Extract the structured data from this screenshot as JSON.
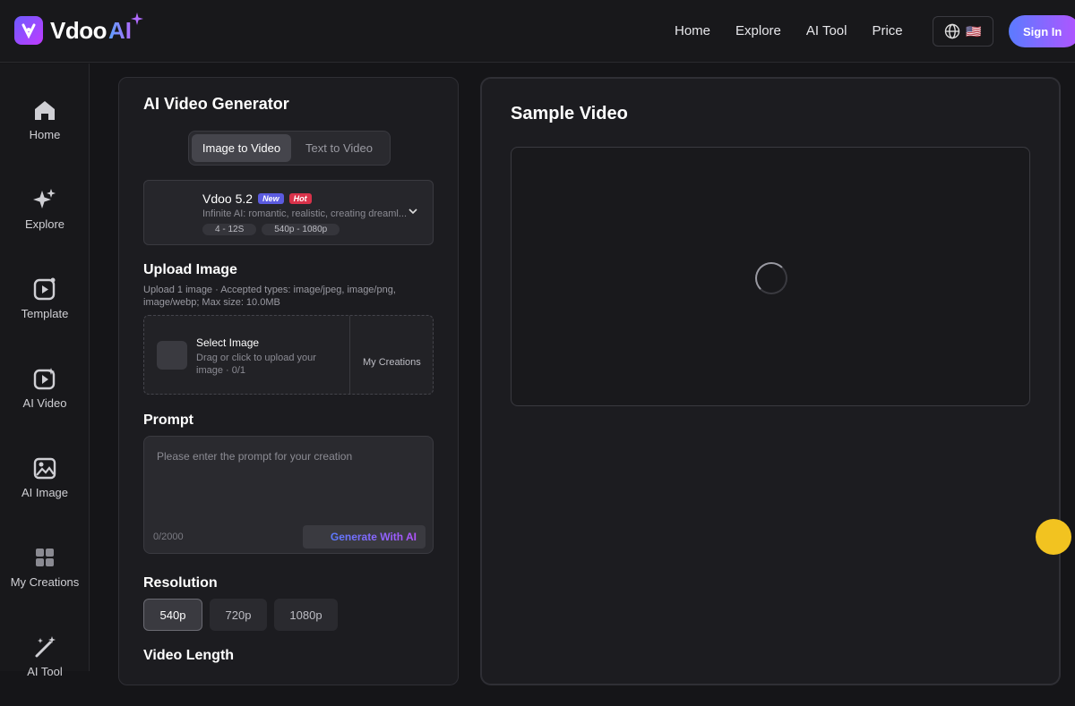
{
  "brand": {
    "name": "Vdoo",
    "ai": "AI"
  },
  "nav": {
    "items": [
      "Home",
      "Explore",
      "AI Tool",
      "Price"
    ]
  },
  "lang": {
    "flag": "🇺🇸"
  },
  "auth": {
    "signin": "Sign In"
  },
  "sidebar": {
    "items": [
      {
        "label": "Home",
        "icon": "home-icon"
      },
      {
        "label": "Explore",
        "icon": "sparkles-icon"
      },
      {
        "label": "Template",
        "icon": "template-icon"
      },
      {
        "label": "AI Video",
        "icon": "ai-video-icon"
      },
      {
        "label": "AI Image",
        "icon": "ai-image-icon"
      },
      {
        "label": "My Creations",
        "icon": "grid-icon"
      },
      {
        "label": "AI Tool",
        "icon": "magic-wand-icon"
      }
    ]
  },
  "generator": {
    "title": "AI Video Generator",
    "tabs": [
      "Image to Video",
      "Text to Video"
    ],
    "model": {
      "name": "Vdoo 5.2",
      "badge_new": "New",
      "badge_hot": "Hot",
      "description": "Infinite AI: romantic, realistic, creating dreaml...",
      "duration": "4 - 12S",
      "resolution_range": "540p - 1080p"
    },
    "upload": {
      "title": "Upload Image",
      "hint": "Upload 1 image · Accepted types: image/jpeg, image/png, image/webp; Max size: 10.0MB",
      "select_title": "Select Image",
      "select_sub": "Drag or click to upload your image · 0/1",
      "my_creations": "My Creations"
    },
    "prompt": {
      "title": "Prompt",
      "placeholder": "Please enter the prompt for your creation",
      "count": "0/2000",
      "generate_ai": "Generate With AI"
    },
    "resolution": {
      "title": "Resolution",
      "options": [
        "540p",
        "720p",
        "1080p"
      ],
      "selected": "540p"
    },
    "length": {
      "title": "Video Length"
    }
  },
  "preview": {
    "title": "Sample Video"
  }
}
